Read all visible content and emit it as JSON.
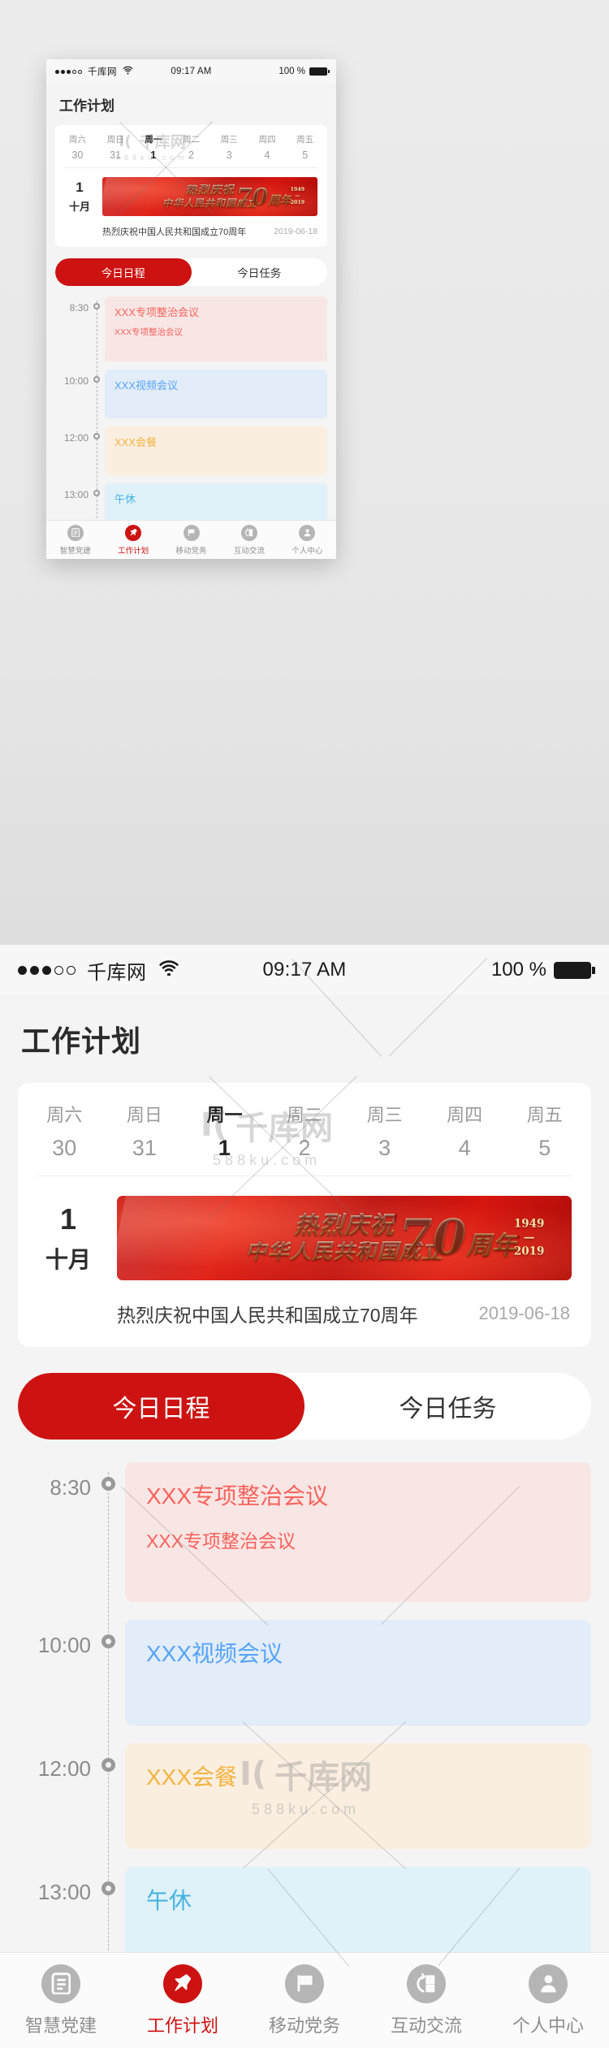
{
  "status_bar": {
    "signal_dots_filled": 3,
    "signal_dots_empty": 2,
    "carrier": "千库网",
    "wifi_icon": "wifi-icon",
    "time": "09:17 AM",
    "battery_percent": "100 %"
  },
  "header": {
    "title": "工作计划"
  },
  "calendar": {
    "days": [
      {
        "name": "周六",
        "num": "30",
        "active": false
      },
      {
        "name": "周日",
        "num": "31",
        "active": false
      },
      {
        "name": "周一",
        "num": "1",
        "active": true
      },
      {
        "name": "周二",
        "num": "2",
        "active": false
      },
      {
        "name": "周三",
        "num": "3",
        "active": false
      },
      {
        "name": "周四",
        "num": "4",
        "active": false
      },
      {
        "name": "周五",
        "num": "5",
        "active": false
      }
    ],
    "selected_day_number": "1",
    "selected_month": "十月",
    "banner": {
      "line1": "热烈庆祝",
      "line2": "中华人民共和国成立",
      "big_number": "70",
      "unit": "周年",
      "year_from": "1949",
      "year_to": "2019"
    },
    "caption": "热烈庆祝中国人民共和国成立70周年",
    "caption_date": "2019-06-18"
  },
  "tabs": {
    "items": [
      {
        "label": "今日日程",
        "active": true
      },
      {
        "label": "今日任务",
        "active": false
      }
    ]
  },
  "schedule": {
    "events": [
      {
        "time": "8:30",
        "title": "XXX专项整治会议",
        "subtitle": "XXX专项整治会议",
        "color": "red",
        "size": "1"
      },
      {
        "time": "10:00",
        "title": "XXX视频会议",
        "subtitle": "",
        "color": "blue",
        "size": "2"
      },
      {
        "time": "12:00",
        "title": "XXX会餐",
        "subtitle": "",
        "color": "orange",
        "size": "3"
      },
      {
        "time": "13:00",
        "title": "午休",
        "subtitle": "",
        "color": "cyan",
        "size": "4"
      }
    ]
  },
  "bottom_nav": {
    "items": [
      {
        "label": "智慧党建",
        "icon": "document-icon",
        "active": false
      },
      {
        "label": "工作计划",
        "icon": "pin-icon",
        "active": true
      },
      {
        "label": "移动党务",
        "icon": "flag-icon",
        "active": false
      },
      {
        "label": "互动交流",
        "icon": "exchange-icon",
        "active": false
      },
      {
        "label": "个人中心",
        "icon": "person-icon",
        "active": false
      }
    ]
  },
  "watermark": {
    "brand": "千库网",
    "site": "588ku.com"
  },
  "colors": {
    "accent_red": "#cd1212",
    "banner_red": "#d6160f",
    "event_red": "#f8625b",
    "event_blue": "#54a4f6",
    "event_orange": "#f3b33f",
    "event_cyan": "#45b3e0",
    "muted_text": "#9a9a9a"
  }
}
